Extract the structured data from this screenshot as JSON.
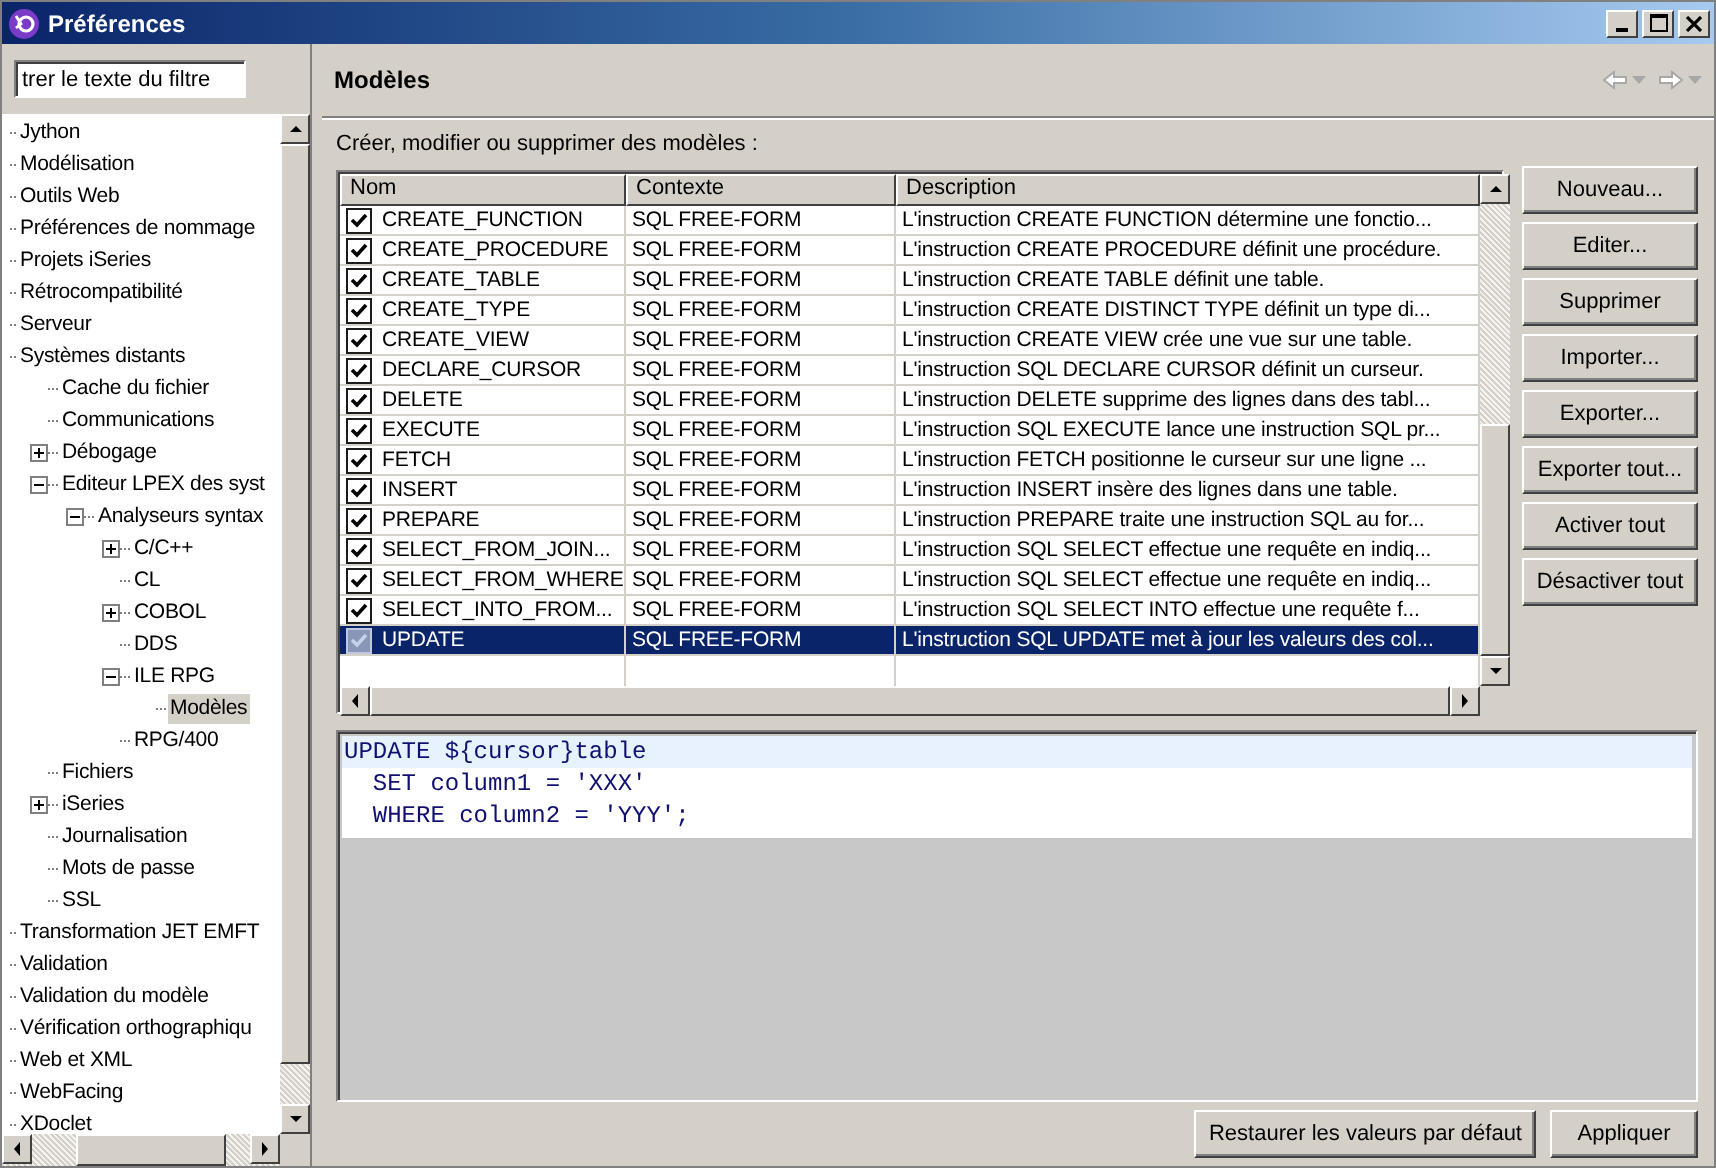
{
  "window": {
    "title": "Préférences"
  },
  "filter": {
    "value": "trer le texte du filtre"
  },
  "tree": [
    {
      "label": "Jython",
      "selected": false
    },
    {
      "label": "Modélisation",
      "selected": false
    },
    {
      "label": "Outils Web",
      "selected": false
    },
    {
      "label": "Préférences de nommage",
      "selected": false
    },
    {
      "label": "Projets iSeries",
      "selected": false
    },
    {
      "label": "Rétrocompatibilité",
      "selected": false
    },
    {
      "label": "Serveur",
      "selected": false
    },
    {
      "label": "Systèmes distants",
      "selected": false,
      "children": [
        {
          "label": "Cache du fichier",
          "selected": false
        },
        {
          "label": "Communications",
          "selected": false
        },
        {
          "label": "Débogage",
          "selected": false,
          "expanded": false
        },
        {
          "label": "Editeur LPEX des syst",
          "selected": false,
          "expanded": true,
          "children": [
            {
              "label": "Analyseurs syntax",
              "selected": false,
              "expanded": true,
              "children": [
                {
                  "label": "C/C++",
                  "selected": false,
                  "expanded": false
                },
                {
                  "label": "CL",
                  "selected": false
                },
                {
                  "label": "COBOL",
                  "selected": false,
                  "expanded": false
                },
                {
                  "label": "DDS",
                  "selected": false
                },
                {
                  "label": "ILE RPG",
                  "selected": false,
                  "expanded": true,
                  "children": [
                    {
                      "label": "Modèles",
                      "selected": true
                    }
                  ]
                },
                {
                  "label": "RPG/400",
                  "selected": false
                }
              ]
            }
          ]
        },
        {
          "label": "Fichiers",
          "selected": false
        },
        {
          "label": "iSeries",
          "selected": false,
          "expanded": false
        },
        {
          "label": "Journalisation",
          "selected": false
        },
        {
          "label": "Mots de passe",
          "selected": false
        },
        {
          "label": "SSL",
          "selected": false
        }
      ]
    },
    {
      "label": "Transformation JET EMFT",
      "selected": false
    },
    {
      "label": "Validation",
      "selected": false
    },
    {
      "label": "Validation du modèle",
      "selected": false
    },
    {
      "label": "Vérification orthographiqu",
      "selected": false
    },
    {
      "label": "Web et XML",
      "selected": false
    },
    {
      "label": "WebFacing",
      "selected": false
    },
    {
      "label": "XDoclet",
      "selected": false
    }
  ],
  "page": {
    "title": "Modèles",
    "nav_buttons": [
      {
        "kind": "back",
        "disabled": true
      },
      {
        "kind": "forward",
        "disabled": true
      }
    ],
    "description": "Créer, modifier ou supprimer des modèles :"
  },
  "table": {
    "columns": [
      "Nom",
      "Contexte",
      "Description"
    ],
    "rows": [
      {
        "name": "CREATE_FUNCTION",
        "context": "SQL FREE-FORM",
        "description": "L'instruction CREATE FUNCTION détermine une fonctio...",
        "checked": true,
        "selected": false
      },
      {
        "name": "CREATE_PROCEDURE",
        "context": "SQL FREE-FORM",
        "description": "L'instruction CREATE PROCEDURE définit une procédure.",
        "checked": true,
        "selected": false
      },
      {
        "name": "CREATE_TABLE",
        "context": "SQL FREE-FORM",
        "description": "L'instruction CREATE TABLE définit une table.",
        "checked": true,
        "selected": false
      },
      {
        "name": "CREATE_TYPE",
        "context": "SQL FREE-FORM",
        "description": "L'instruction CREATE DISTINCT TYPE définit un type di...",
        "checked": true,
        "selected": false
      },
      {
        "name": "CREATE_VIEW",
        "context": "SQL FREE-FORM",
        "description": "L'instruction CREATE VIEW crée une vue sur une table.",
        "checked": true,
        "selected": false
      },
      {
        "name": "DECLARE_CURSOR",
        "context": "SQL FREE-FORM",
        "description": "L'instruction SQL DECLARE CURSOR définit un curseur.",
        "checked": true,
        "selected": false
      },
      {
        "name": "DELETE",
        "context": "SQL FREE-FORM",
        "description": "L'instruction DELETE supprime des lignes dans des tabl...",
        "checked": true,
        "selected": false
      },
      {
        "name": "EXECUTE",
        "context": "SQL FREE-FORM",
        "description": "L'instruction SQL EXECUTE lance une instruction SQL pr...",
        "checked": true,
        "selected": false
      },
      {
        "name": "FETCH",
        "context": "SQL FREE-FORM",
        "description": "L'instruction FETCH positionne le curseur sur une ligne ...",
        "checked": true,
        "selected": false
      },
      {
        "name": "INSERT",
        "context": "SQL FREE-FORM",
        "description": "L'instruction INSERT insère des lignes dans une table.",
        "checked": true,
        "selected": false
      },
      {
        "name": "PREPARE",
        "context": "SQL FREE-FORM",
        "description": "L'instruction PREPARE traite une instruction SQL au for...",
        "checked": true,
        "selected": false
      },
      {
        "name": "SELECT_FROM_JOIN...",
        "context": "SQL FREE-FORM",
        "description": "L'instruction SQL SELECT effectue une requête en indiq...",
        "checked": true,
        "selected": false
      },
      {
        "name": "SELECT_FROM_WHERE",
        "context": "SQL FREE-FORM",
        "description": "L'instruction SQL SELECT effectue une requête en indiq...",
        "checked": true,
        "selected": false
      },
      {
        "name": "SELECT_INTO_FROM...",
        "context": "SQL FREE-FORM",
        "description": "L'instruction SQL SELECT INTO effectue une requête f...",
        "checked": true,
        "selected": false
      },
      {
        "name": "UPDATE",
        "context": "SQL FREE-FORM",
        "description": "L'instruction SQL UPDATE met à jour les valeurs des col...",
        "checked": true,
        "selected": true
      }
    ]
  },
  "side_buttons": [
    "Nouveau...",
    "Editer...",
    "Supprimer",
    "Importer...",
    "Exporter...",
    "Exporter tout...",
    "Activer tout",
    "Désactiver tout"
  ],
  "editor": {
    "lines": [
      {
        "text": "UPDATE ${cursor}table",
        "current": true
      },
      {
        "text": "  SET column1 = 'XXX'",
        "current": false
      },
      {
        "text": "  WHERE column2 = 'YYY';",
        "current": false
      }
    ]
  },
  "footer_buttons": [
    "Restaurer les valeurs par défaut",
    "Appliquer"
  ]
}
